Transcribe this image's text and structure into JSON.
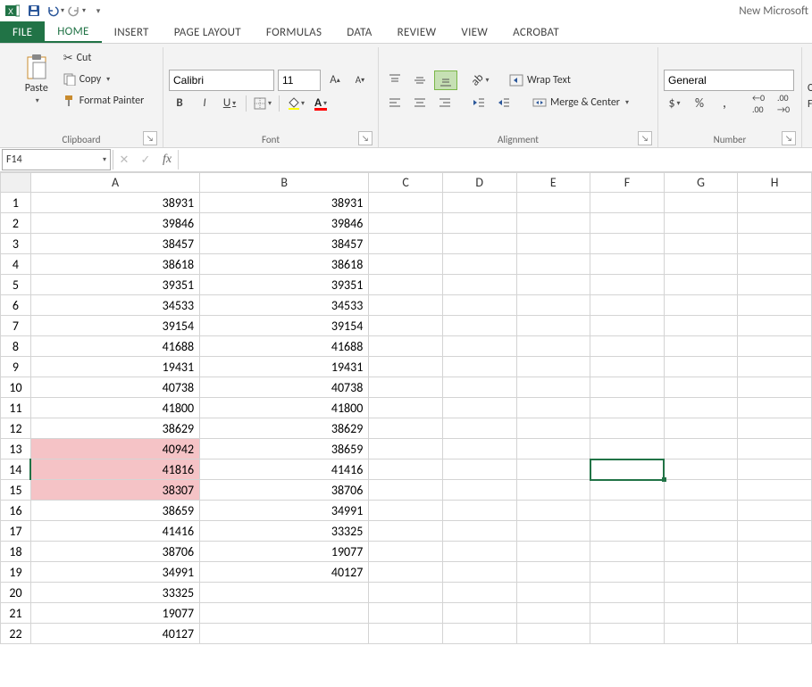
{
  "app": {
    "doc_title": "New Microsoft"
  },
  "tabs": {
    "file": "FILE",
    "home": "HOME",
    "insert": "INSERT",
    "page_layout": "PAGE LAYOUT",
    "formulas": "FORMULAS",
    "data": "DATA",
    "review": "REVIEW",
    "view": "VIEW",
    "acrobat": "ACROBAT"
  },
  "ribbon": {
    "clipboard": {
      "paste": "Paste",
      "cut": "Cut",
      "copy": "Copy",
      "format_painter": "Format Painter",
      "label": "Clipboard"
    },
    "font": {
      "name": "Calibri",
      "size": "11",
      "label": "Font"
    },
    "alignment": {
      "wrap": "Wrap Text",
      "merge": "Merge & Center",
      "label": "Alignment"
    },
    "number": {
      "format": "General",
      "label": "Number"
    },
    "cells_hint1": "C",
    "cells_hint2": "Fo"
  },
  "formula_bar": {
    "name_box": "F14",
    "formula": ""
  },
  "grid": {
    "columns": [
      "A",
      "B",
      "C",
      "D",
      "E",
      "F",
      "G",
      "H"
    ],
    "selected_cell": "F14",
    "rows": [
      {
        "n": 1,
        "A": "38931",
        "B": "38931"
      },
      {
        "n": 2,
        "A": "39846",
        "B": "39846"
      },
      {
        "n": 3,
        "A": "38457",
        "B": "38457"
      },
      {
        "n": 4,
        "A": "38618",
        "B": "38618"
      },
      {
        "n": 5,
        "A": "39351",
        "B": "39351"
      },
      {
        "n": 6,
        "A": "34533",
        "B": "34533"
      },
      {
        "n": 7,
        "A": "39154",
        "B": "39154"
      },
      {
        "n": 8,
        "A": "41688",
        "B": "41688"
      },
      {
        "n": 9,
        "A": "19431",
        "B": "19431"
      },
      {
        "n": 10,
        "A": "40738",
        "B": "40738"
      },
      {
        "n": 11,
        "A": "41800",
        "B": "41800"
      },
      {
        "n": 12,
        "A": "38629",
        "B": "38629"
      },
      {
        "n": 13,
        "A": "40942",
        "B": "38659",
        "hlA": true
      },
      {
        "n": 14,
        "A": "41816",
        "B": "41416",
        "hlA": true,
        "active": true
      },
      {
        "n": 15,
        "A": "38307",
        "B": "38706",
        "hlA": true
      },
      {
        "n": 16,
        "A": "38659",
        "B": "34991"
      },
      {
        "n": 17,
        "A": "41416",
        "B": "33325"
      },
      {
        "n": 18,
        "A": "38706",
        "B": "19077"
      },
      {
        "n": 19,
        "A": "34991",
        "B": "40127"
      },
      {
        "n": 20,
        "A": "33325",
        "B": ""
      },
      {
        "n": 21,
        "A": "19077",
        "B": ""
      },
      {
        "n": 22,
        "A": "40127",
        "B": ""
      }
    ]
  }
}
